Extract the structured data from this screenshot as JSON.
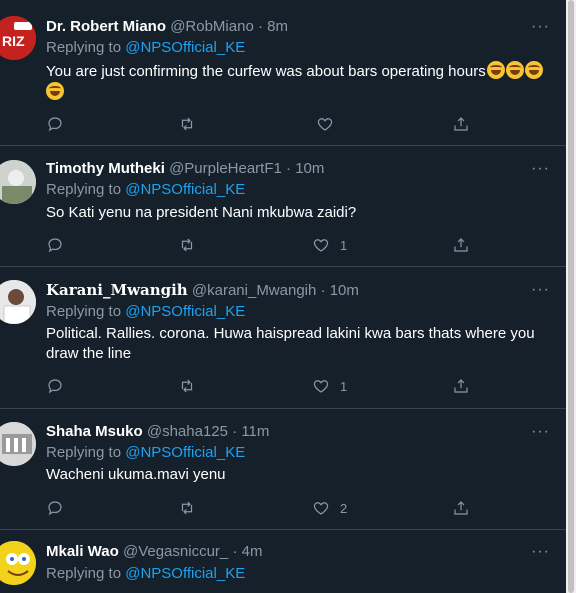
{
  "reply_prefix": "Replying to",
  "tweets": [
    {
      "name": "Dr. Robert Miano",
      "handle": "@RobMiano",
      "separator": "·",
      "time": "8m",
      "reply_to": "@NPSOfficial_KE",
      "text": "You are just confirming the curfew was about bars operating hours",
      "emoji_count": 4,
      "likes": "",
      "more": "···"
    },
    {
      "name": "Timothy Mutheki",
      "handle": "@PurpleHeartF1",
      "separator": "·",
      "time": "10m",
      "reply_to": "@NPSOfficial_KE",
      "text": "So Kati yenu na president Nani mkubwa zaidi?",
      "likes": "1",
      "more": "···"
    },
    {
      "name": "Karani_Mwangih",
      "handle": "@karani_Mwangih",
      "separator": "·",
      "time": "10m",
      "reply_to": "@NPSOfficial_KE",
      "text": "Political. Rallies. corona. Huwa haispread lakini kwa bars thats where you draw the line",
      "likes": "1",
      "more": "···"
    },
    {
      "name": "Shaha Msuko",
      "handle": "@shaha125",
      "separator": "·",
      "time": "11m",
      "reply_to": "@NPSOfficial_KE",
      "text": "Wacheni ukuma.mavi yenu",
      "likes": "2",
      "more": "···"
    },
    {
      "name": "Mkali Wao",
      "handle": "@Vegasniccur_",
      "separator": "·",
      "time": "4m",
      "reply_to": "@NPSOfficial_KE",
      "text": "",
      "likes": "",
      "more": "···"
    }
  ],
  "colors": {
    "background": "#15202b",
    "border": "#38444d",
    "secondary_text": "#8899a6",
    "link": "#1da1f2"
  },
  "icons": [
    "reply-icon",
    "retweet-icon",
    "like-icon",
    "share-icon",
    "more-icon"
  ]
}
